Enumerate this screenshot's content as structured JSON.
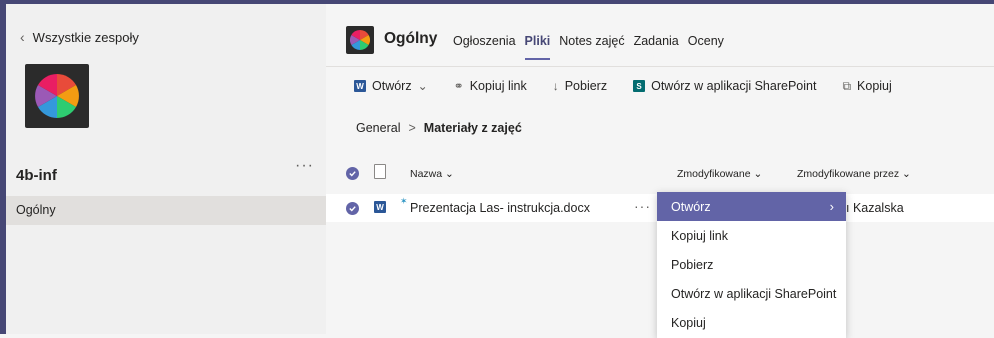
{
  "sidebar": {
    "back_label": "Wszystkie zespoły",
    "team_name": "4b-inf",
    "more": "···",
    "channels": [
      {
        "label": "Ogólny"
      }
    ]
  },
  "channel": {
    "title": "Ogólny",
    "tabs": [
      {
        "label": "Ogłoszenia"
      },
      {
        "label": "Pliki"
      },
      {
        "label": "Notes zajęć"
      },
      {
        "label": "Zadania"
      },
      {
        "label": "Oceny"
      }
    ],
    "active_tab": "Pliki"
  },
  "toolbar": {
    "open_label": "Otwórz",
    "copy_link_label": "Kopiuj link",
    "download_label": "Pobierz",
    "open_sharepoint_label": "Otwórz w aplikacji SharePoint",
    "copy_label": "Kopiuj"
  },
  "breadcrumb": {
    "root": "General",
    "sep": ">",
    "current": "Materiały z zajęć"
  },
  "list": {
    "headers": {
      "name": "Nazwa",
      "modified": "Zmodyfikowane",
      "modified_by": "Zmodyfikowane przez"
    },
    "rows": [
      {
        "name": "Prezentacja Las- instrukcja.docx",
        "more": "···",
        "modified_by": "ı Kazalska"
      }
    ]
  },
  "context_menu": {
    "items": [
      {
        "label": "Otwórz"
      },
      {
        "label": "Kopiuj link"
      },
      {
        "label": "Pobierz"
      },
      {
        "label": "Otwórz w aplikacji SharePoint"
      },
      {
        "label": "Kopiuj"
      }
    ]
  },
  "colors": {
    "accent": "#6264a7",
    "frame": "#464775"
  }
}
